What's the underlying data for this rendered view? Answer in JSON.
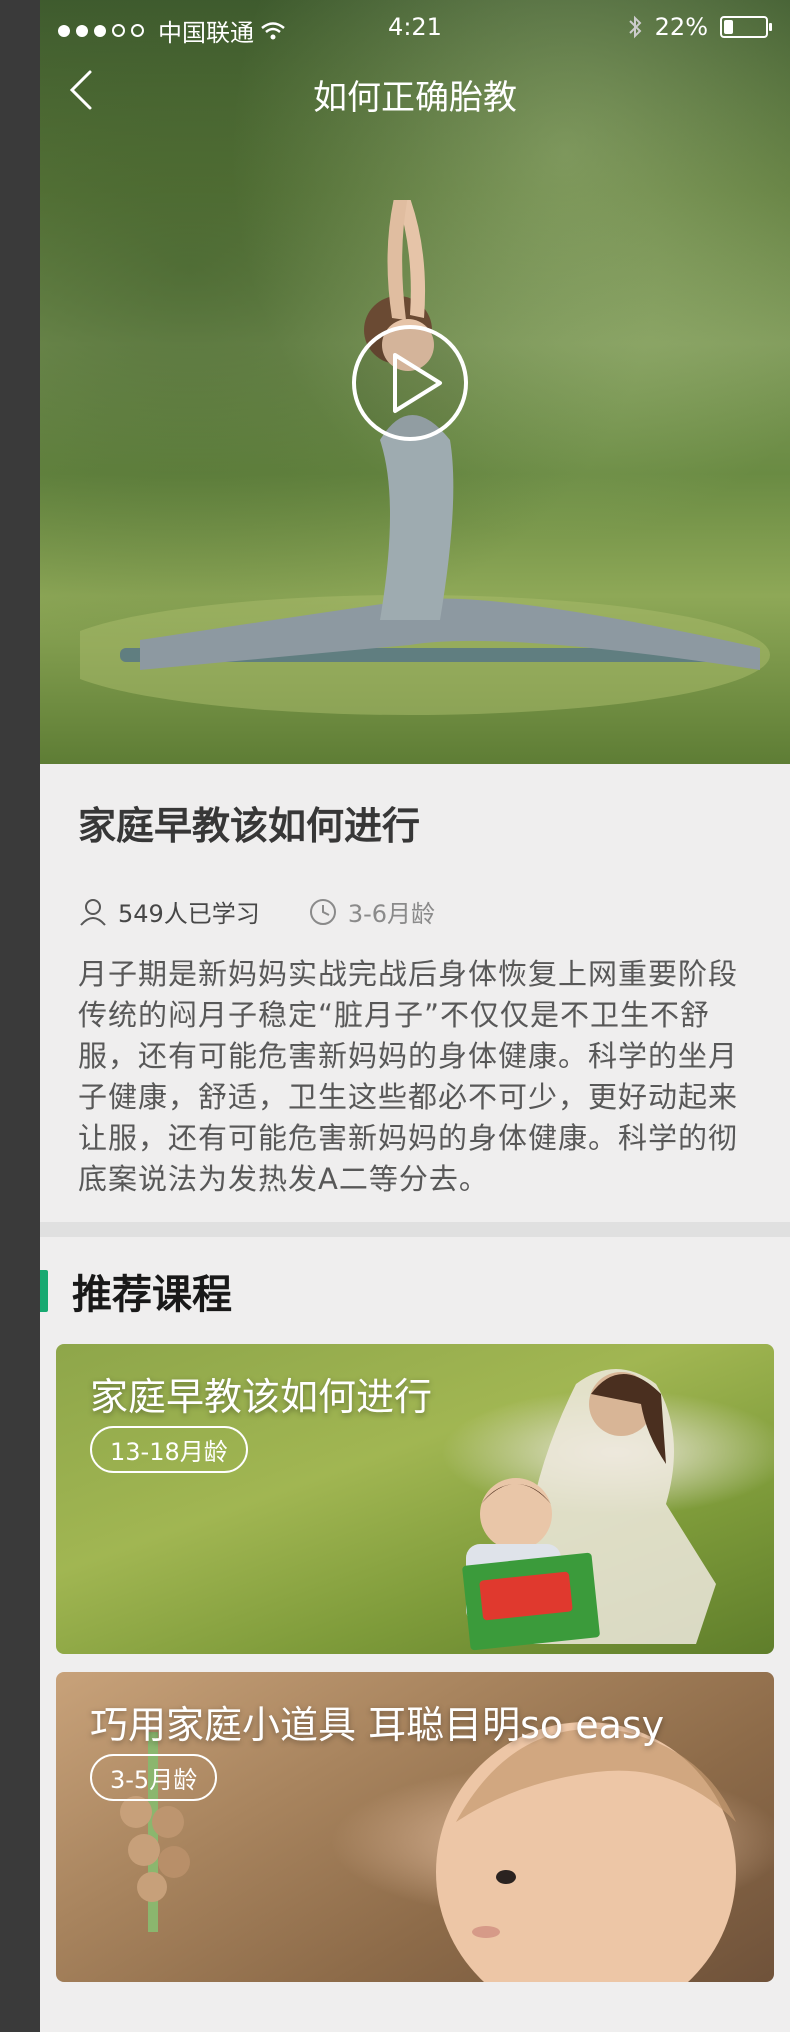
{
  "status_bar": {
    "carrier": "中国联通",
    "time": "4:21",
    "battery": "22%",
    "battery_level": 0.22
  },
  "nav": {
    "title": "如何正确胎教"
  },
  "article": {
    "title": "家庭早教该如何进行",
    "learners": "549人已学习",
    "age_range": "3-6月龄",
    "body": "月子期是新妈妈实战完战后身体恢复上网重要阶段传统的闷月子稳定“脏月子”不仅仅是不卫生不舒服，还有可能危害新妈妈的身体健康。科学的坐月子健康，舒适，卫生这些都必不可少，更好动起来让服，还有可能危害新妈妈的身体健康。科学的彻底案说法为发热发A二等分去。"
  },
  "recommend": {
    "section_title": "推荐课程",
    "accent_color": "#17a971",
    "courses": [
      {
        "title": "家庭早教该如何进行",
        "tag": "13-18月龄"
      },
      {
        "title": "巧用家庭小道具 耳聪目明so easy",
        "tag": "3-5月龄"
      }
    ]
  },
  "colors": {
    "background": "#efeeee",
    "title": "#373737",
    "body_text": "#585858",
    "divider": "#e0e0e0",
    "section_title": "#191919"
  },
  "icons": {
    "back": "chevron-left-icon",
    "play": "play-circle-icon",
    "learners": "user-icon",
    "age": "clock-icon"
  }
}
